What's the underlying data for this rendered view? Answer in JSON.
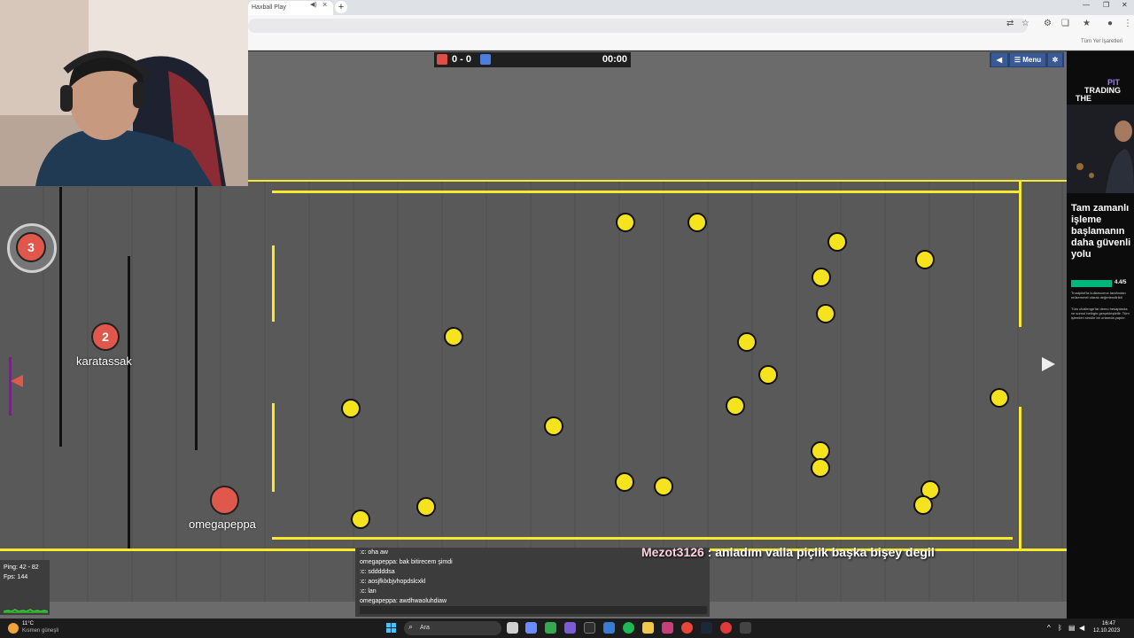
{
  "browser": {
    "tab_title": "Haxball Play",
    "bookmarks_label": "Tüm Yer İşaretleri"
  },
  "scoreboard": {
    "red_color": "#e04e44",
    "blue_color": "#4a7fe0",
    "score": "0 - 0",
    "timer": "00:00"
  },
  "menu": {
    "menu_label": "Menu",
    "sound_icon": "speaker-icon",
    "settings_icon": "gear-icon"
  },
  "players": [
    {
      "number": "3",
      "name": ""
    },
    {
      "number": "2",
      "name": "karatassak"
    },
    {
      "number": "",
      "name": "omegapeppa"
    }
  ],
  "chat": {
    "lines": [
      ":c: oha aw",
      "omegapeppa: bak bitirecem şimdi",
      ":c: sdddddsa",
      ":c: aosjfklxbjvhopdslcxkl",
      ":c: lan",
      "omegapeppa: awdhwaoluhdiaw"
    ],
    "overlay_nick": "Mezot3126",
    "overlay_message": ": anladım valla piçlik başka bişey degil"
  },
  "stats": {
    "ping": "Ping: 42 - 82",
    "fps": "Fps: 144"
  },
  "ad": {
    "line1": "PIT",
    "line2": "TRADING",
    "line3": "THE",
    "headline": "Tam zamanlı işleme başlamanın daha güvenli yolu",
    "rating": "4.4/5",
    "sub1": "Trustpilot'ta kullanıcımız tarafından mükemmel olarak değerlendirildi",
    "sub2": "Tüm challenge'lar demo hesaplarda ve somut belirgin gerçekleştirilir. Tüm işlemleri simüle bir ortamda yapılır."
  },
  "taskbar": {
    "weather_temp": "11°C",
    "weather_desc": "Kısmen güneşli",
    "search_placeholder": "Ara",
    "time": "16:47",
    "date": "12.10.2023"
  }
}
